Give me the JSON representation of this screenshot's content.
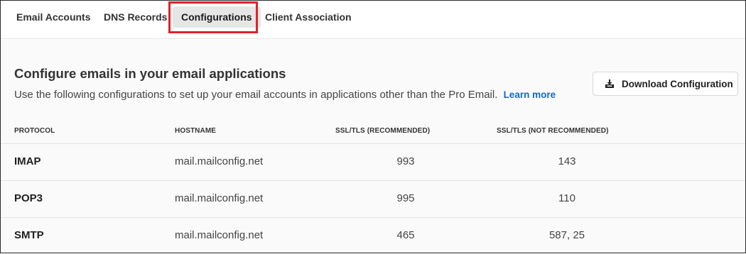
{
  "tabs": [
    {
      "label": "Email Accounts"
    },
    {
      "label": "DNS Records"
    },
    {
      "label": "Configurations"
    },
    {
      "label": "Client Association"
    }
  ],
  "main": {
    "title": "Configure emails in your email applications",
    "description": "Use the following configurations to set up your email accounts in applications other than the Pro Email.",
    "learn_more": "Learn more",
    "download_label": "Download Configuration"
  },
  "table": {
    "headers": [
      "PROTOCOL",
      "HOSTNAME",
      "SSL/TLS (RECOMMENDED)",
      "SSL/TLS (NOT RECOMMENDED)"
    ],
    "rows": [
      {
        "protocol": "IMAP",
        "hostname": "mail.mailconfig.net",
        "ssl": "993",
        "non_ssl": "143"
      },
      {
        "protocol": "POP3",
        "hostname": "mail.mailconfig.net",
        "ssl": "995",
        "non_ssl": "110"
      },
      {
        "protocol": "SMTP",
        "hostname": "mail.mailconfig.net",
        "ssl": "465",
        "non_ssl": "587, 25"
      }
    ]
  },
  "icons": {
    "download": "download-icon"
  },
  "colors": {
    "highlight": "#e3202a",
    "link": "#1468c8",
    "active_tab": "#e6e6e6"
  }
}
